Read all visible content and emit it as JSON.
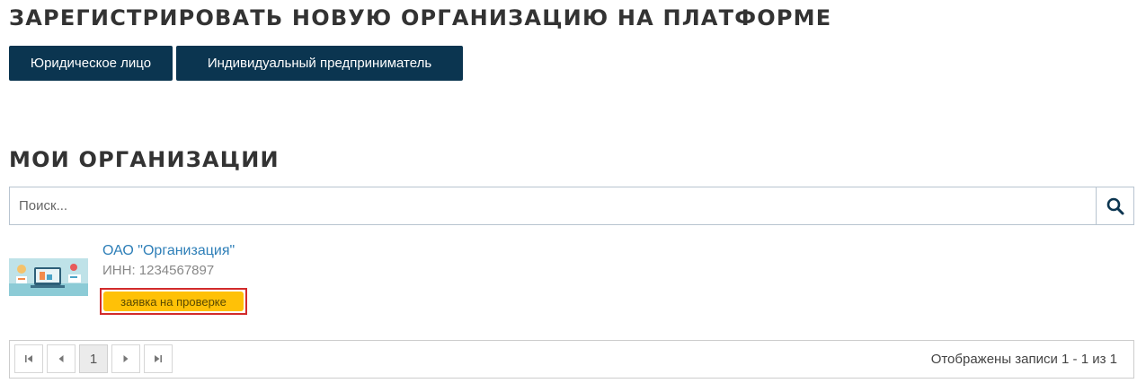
{
  "register": {
    "title": "ЗАРЕГИСТРИРОВАТЬ НОВУЮ ОРГАНИЗАЦИЮ НА ПЛАТФОРМЕ",
    "buttons": {
      "legal_entity": "Юридическое лицо",
      "sole_proprietor": "Индивидуальный предприниматель"
    }
  },
  "my_orgs": {
    "title": "МОИ ОРГАНИЗАЦИИ",
    "search": {
      "placeholder": "Поиск...",
      "value": "",
      "button_icon": "search-icon"
    },
    "items": [
      {
        "name": "ОАО \"Организация\"",
        "inn": "ИНН: 1234567897",
        "status": "заявка на проверке",
        "status_color": "#ffc107",
        "thumbnail_icon": "organization-illustration"
      }
    ]
  },
  "pagination": {
    "first_icon": "first-page-icon",
    "prev_icon": "prev-page-icon",
    "current_page": "1",
    "next_icon": "next-page-icon",
    "last_icon": "last-page-icon",
    "info": "Отображены записи 1 - 1 из 1"
  },
  "colors": {
    "primary_button": "#0b3550",
    "link": "#2e7fb8",
    "status_badge": "#ffc107",
    "highlight_border": "#d22b2b"
  }
}
